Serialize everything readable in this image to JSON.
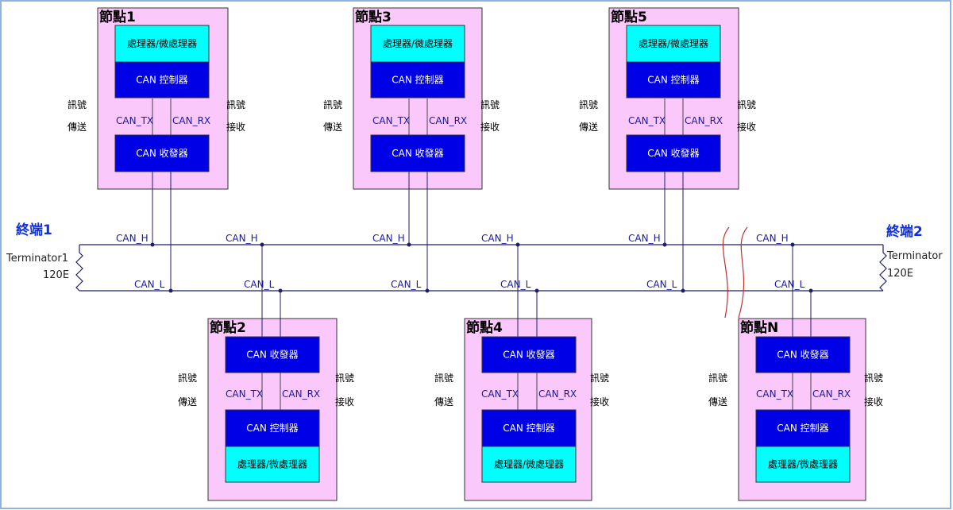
{
  "colors": {
    "node_fill": "#fbc8fb",
    "processor_fill": "#00ffff",
    "can_block_fill": "#0000e6",
    "bus_line": "#1e1e6e",
    "break_mark": "#c03030",
    "terminal_label": "#1030e0",
    "frame": "#8fb4e0"
  },
  "terminals": [
    {
      "title": "終端1",
      "name": "Terminator1",
      "value": "120E"
    },
    {
      "title": "終端2",
      "name": "Terminator",
      "value": "120E"
    }
  ],
  "bus_labels": {
    "high": "CAN_H",
    "low": "CAN_L"
  },
  "nodes": [
    {
      "title": "節點1",
      "position": "top"
    },
    {
      "title": "節點2",
      "position": "bottom"
    },
    {
      "title": "節點3",
      "position": "top"
    },
    {
      "title": "節點4",
      "position": "bottom"
    },
    {
      "title": "節點5",
      "position": "top"
    },
    {
      "title": "節點N",
      "position": "bottom"
    }
  ],
  "blocks": {
    "processor": "處理器/微處理器",
    "controller": "CAN 控制器",
    "transceiver": "CAN 收發器"
  },
  "signals": {
    "tx": "CAN_TX",
    "rx": "CAN_RX",
    "send_line1": "訊號",
    "send_line2": "傳送",
    "recv_line1": "訊號",
    "recv_line2": "接收"
  }
}
